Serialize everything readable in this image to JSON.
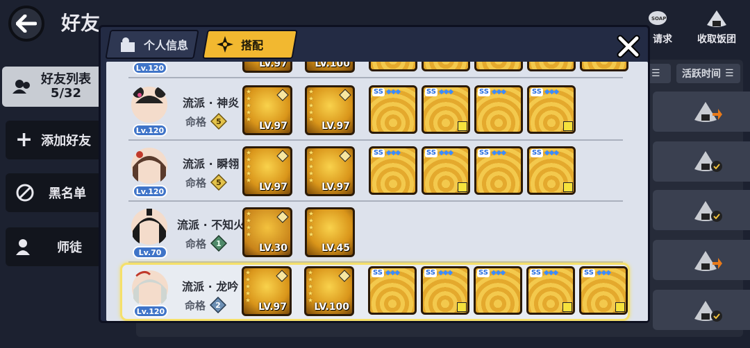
{
  "header": {
    "title": "好友"
  },
  "top_actions": [
    {
      "label": "请求",
      "icon": "soap-bubble-icon"
    },
    {
      "label": "收取饭团",
      "icon": "rice-ball-icon"
    }
  ],
  "sidebar": {
    "items": [
      {
        "label": "好友列表",
        "sub": "5/32",
        "icon": "friends-icon",
        "active": true
      },
      {
        "label": "添加好友",
        "icon": "plus-icon"
      },
      {
        "label": "黑名单",
        "icon": "block-icon"
      },
      {
        "label": "师徒",
        "icon": "master-icon"
      }
    ]
  },
  "sort": {
    "activity_label": "活跃时间"
  },
  "modal": {
    "tabs": [
      {
        "label": "个人信息",
        "icon": "profile-icon"
      },
      {
        "label": "搭配",
        "icon": "shuriken-icon",
        "active": true
      }
    ],
    "rows": [
      {
        "avatar_level": "Lv.120",
        "school": "流派 · 神炎",
        "mingge_label": "命格",
        "mingge_rank": "5",
        "weapons": [
          {
            "level": "LV.97"
          },
          {
            "level": "LV.97"
          }
        ],
        "accessories": 4
      },
      {
        "avatar_level": "Lv.120",
        "school": "流派 · 瞬翎",
        "mingge_label": "命格",
        "mingge_rank": "5",
        "weapons": [
          {
            "level": "LV.97"
          },
          {
            "level": "LV.97"
          }
        ],
        "accessories": 4
      },
      {
        "avatar_level": "Lv.70",
        "school": "流派 · 不知火",
        "mingge_label": "命格",
        "mingge_rank": "1",
        "weapons": [
          {
            "level": "LV.30"
          },
          {
            "level": "LV.45"
          }
        ],
        "accessories": 0
      },
      {
        "avatar_level": "Lv.120",
        "school": "流派 · 龙吟",
        "mingge_label": "命格",
        "mingge_rank": "2",
        "weapons": [
          {
            "level": "LV.97"
          },
          {
            "level": "LV.100"
          }
        ],
        "accessories": 5
      }
    ],
    "partial_top_row": {
      "avatar_level": "Lv.120",
      "weapons": [
        {
          "level": "LV.97"
        },
        {
          "level": "LV.100"
        }
      ]
    },
    "accessory_tag": {
      "grade": "SS",
      "gems": "◆◆◆"
    }
  },
  "colors": {
    "accent": "#f2b830",
    "level_badge": "#3f74c8",
    "highlight": "#f5e06a"
  }
}
